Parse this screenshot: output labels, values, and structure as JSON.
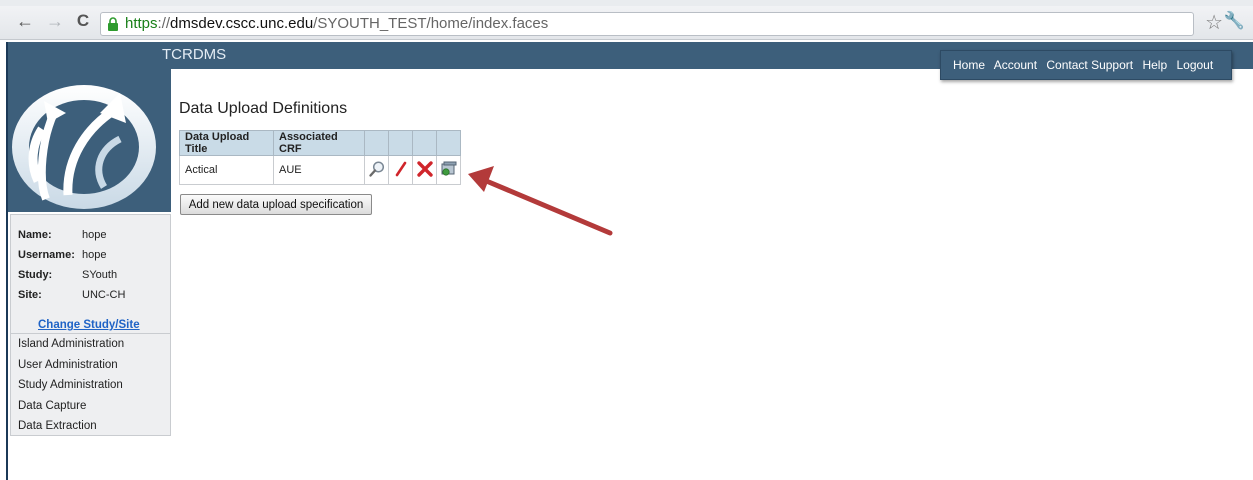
{
  "browser": {
    "url_https": "https",
    "url_sep": "://",
    "url_host": "dmsdev.cscc.unc.edu",
    "url_path": "/SYOUTH_TEST/home/index.faces"
  },
  "app": {
    "title": "TCRDMS"
  },
  "top_menu": [
    "Home",
    "Account",
    "Contact Support",
    "Help",
    "Logout"
  ],
  "user_info": {
    "name_label": "Name:",
    "name_value": "hope",
    "username_label": "Username:",
    "username_value": "hope",
    "study_label": "Study:",
    "study_value": "SYouth",
    "site_label": "Site:",
    "site_value": "UNC-CH",
    "change_link": "Change Study/Site"
  },
  "sidebar_nav": [
    "Island Administration",
    "User Administration",
    "Study Administration",
    "Data Capture",
    "Data Extraction"
  ],
  "main": {
    "heading": "Data Upload Definitions",
    "columns": [
      "Data Upload Title",
      "Associated CRF"
    ],
    "rows": [
      {
        "title": "Actical",
        "crf": "AUE"
      }
    ],
    "add_button": "Add new data upload specification"
  },
  "colors": {
    "header_bg": "#3d5f7b",
    "table_header_bg": "#c9dbe7",
    "link": "#1f63c6",
    "arrow": "#b33a3a"
  }
}
